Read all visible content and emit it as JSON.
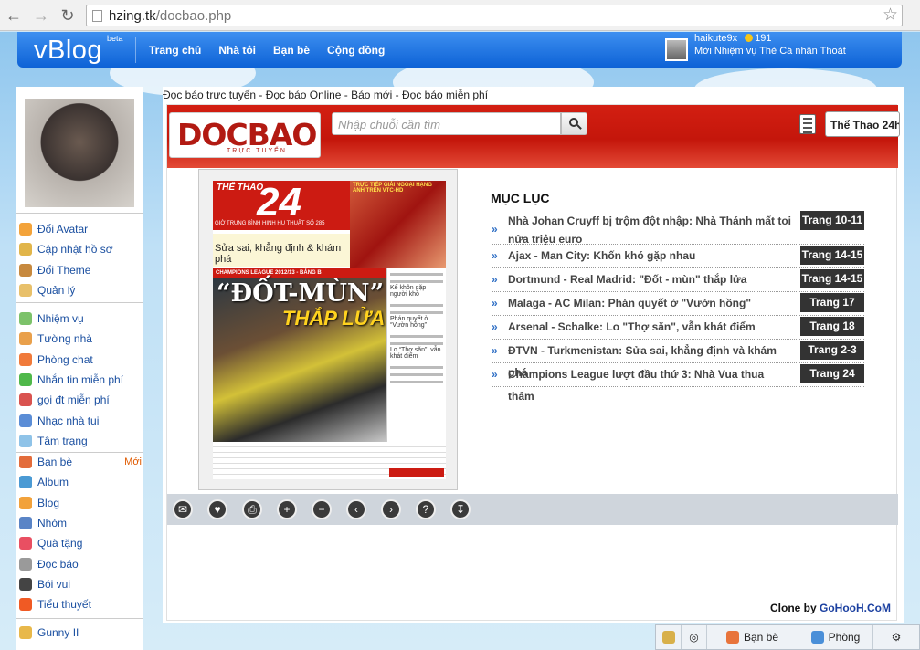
{
  "browser": {
    "url_host": "hzing.tk",
    "url_path": "/docbao.php"
  },
  "vblog": {
    "logo": "vBlog",
    "beta": "beta",
    "nav": [
      "Trang chủ",
      "Nhà tôi",
      "Bạn bè",
      "Cộng đồng"
    ],
    "user": {
      "name": "haikute9x",
      "coins": "191",
      "links": "Mời Nhiệm vụ Thẻ Cá nhân Thoát"
    }
  },
  "sidebar": {
    "group1": [
      "Đổi Avatar",
      "Cập nhật hồ sơ",
      "Đổi Theme",
      "Quản lý"
    ],
    "group2": [
      "Nhiệm vụ",
      "Tường nhà",
      "Phòng chat",
      "Nhắn tin miễn phí",
      "gọi đt miễn phí",
      "Nhạc nhà tui",
      "Tâm trạng"
    ],
    "group3": [
      "Bạn bè",
      "Album",
      "Blog",
      "Nhóm",
      "Quà tặng",
      "Đọc báo",
      "Bói vui",
      "Tiểu thuyết"
    ],
    "group4": [
      "Gunny II"
    ],
    "new_badge": "Mới"
  },
  "main": {
    "breadcrumb": "Đọc báo trực tuyến - Đọc báo Online - Báo mới - Đọc báo miễn phí",
    "brand": "DOCBAO",
    "brand_sub": "TRỰC TUYẾN",
    "search_placeholder": "Nhập chuỗi cần tìm",
    "category": "Thể Thao 24h"
  },
  "cover": {
    "masthead_top": "THỂ THAO",
    "masthead_num": "24",
    "masthead_cap": "GIỜ TRUNG BÌNH HINH HU THUẬT SỐ 285",
    "side_label": "TRỰC TIẾP GIẢI NGOẠI HẠNG ANH TRÊN VTC-HD",
    "subhead": "Sửa sai, khẳng định & khám phá",
    "band": "CHAMPIONS LEAGUE 2012/13 - BẢNG B",
    "headline1": "“ĐỐT-MÙN”",
    "headline2": "THẮP LỬA",
    "col1": "Kế khôn gặp người khó",
    "col2": "Phán quyết ở “Vườn hồng”",
    "col3": "Lo “Thợ săn”, vẫn khát điểm"
  },
  "toc": {
    "title": "MỤC LỤC",
    "items": [
      {
        "title": "Nhà Johan Cruyff bị trộm đột nhập: Nhà Thánh mất toi nửa triệu euro",
        "page": "Trang 10-11"
      },
      {
        "title": "Ajax - Man City: Khốn khó gặp nhau",
        "page": "Trang 14-15"
      },
      {
        "title": "Dortmund - Real Madrid: \"Đốt - mùn\" thắp lửa",
        "page": "Trang 14-15"
      },
      {
        "title": "Malaga - AC Milan: Phán quyết ở \"Vườn hồng\"",
        "page": "Trang 17"
      },
      {
        "title": "Arsenal - Schalke: Lo \"Thợ săn\", vẫn khát điểm",
        "page": "Trang 18"
      },
      {
        "title": "ĐTVN - Turkmenistan: Sửa sai, khẳng định và khám phá",
        "page": "Trang 2-3"
      },
      {
        "title": "Champions League lượt đầu thứ 3: Nhà Vua thua thảm",
        "page": "Trang 24"
      }
    ]
  },
  "toolbar_icons": [
    "mail-icon",
    "heart-icon",
    "print-icon",
    "zoom-in-icon",
    "zoom-out-icon",
    "prev-icon",
    "next-icon",
    "help-icon",
    "download-icon"
  ],
  "clone": {
    "prefix": "Clone by ",
    "name": "GoHooH.CoM"
  },
  "chatbar": {
    "friends": "Bạn bè",
    "rooms": "Phòng"
  }
}
